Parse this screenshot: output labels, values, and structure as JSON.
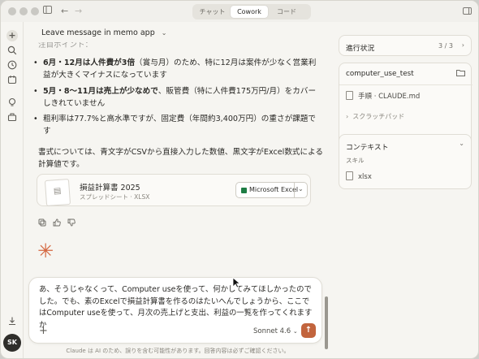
{
  "titlebar": {
    "tabs": [
      {
        "label": "チャット"
      },
      {
        "label": "Cowork"
      },
      {
        "label": "コード"
      }
    ]
  },
  "conversation": {
    "title": "Leave message in memo app",
    "faded_heading": "注目ポイント：",
    "bullets": [
      {
        "bold": "6月・12月は人件費が3倍",
        "text": "（賞与月）のため、特に12月は案件が少なく営業利益が大きくマイナスになっています"
      },
      {
        "bold": "5月・8〜11月は売上が少なめで",
        "text": "、販管費（特に人件費175万円/月）をカバーしきれていません"
      },
      {
        "bold": "",
        "text": "粗利率は77.7%と高水準ですが、固定費（年間約3,400万円）の重さが課題です"
      }
    ],
    "note": "書式については、青文字がCSVから直接入力した数値、黒文字がExcel数式による計算値です。",
    "artifact": {
      "title": "損益計算書 2025",
      "subtitle": "スプレッドシート · XLSX",
      "open_label": "Microsoft Excel"
    }
  },
  "composer": {
    "text": "あ、そうじゃなくって、Computer useを使って、何かしてみてほしかったのでした。でも、素のExcelで損益計算書を作るのはたいへんでしょうから、ここではComputer useを使って、月次の売上げと支出、利益の一覧を作ってくれますか",
    "model": "Sonnet 4.6",
    "disclaimer": "Claude は AI のため、誤りを含む可能性があります。回答内容は必ずご確認ください。"
  },
  "user": {
    "initials": "SK"
  },
  "right_panel": {
    "progress": {
      "title": "進行状況",
      "count": "3 / 3"
    },
    "folder": {
      "title": "computer_use_test",
      "file": "手順 · CLAUDE.md",
      "scratchpad": "スクラッチパッド"
    },
    "context": {
      "title": "コンテキスト",
      "skills_label": "スキル",
      "skill": "xlsx"
    }
  },
  "colors": {
    "accent": "#c2643d",
    "spark": "#d4663f",
    "excel": "#1e7d44",
    "background": "#f6f5f1"
  }
}
